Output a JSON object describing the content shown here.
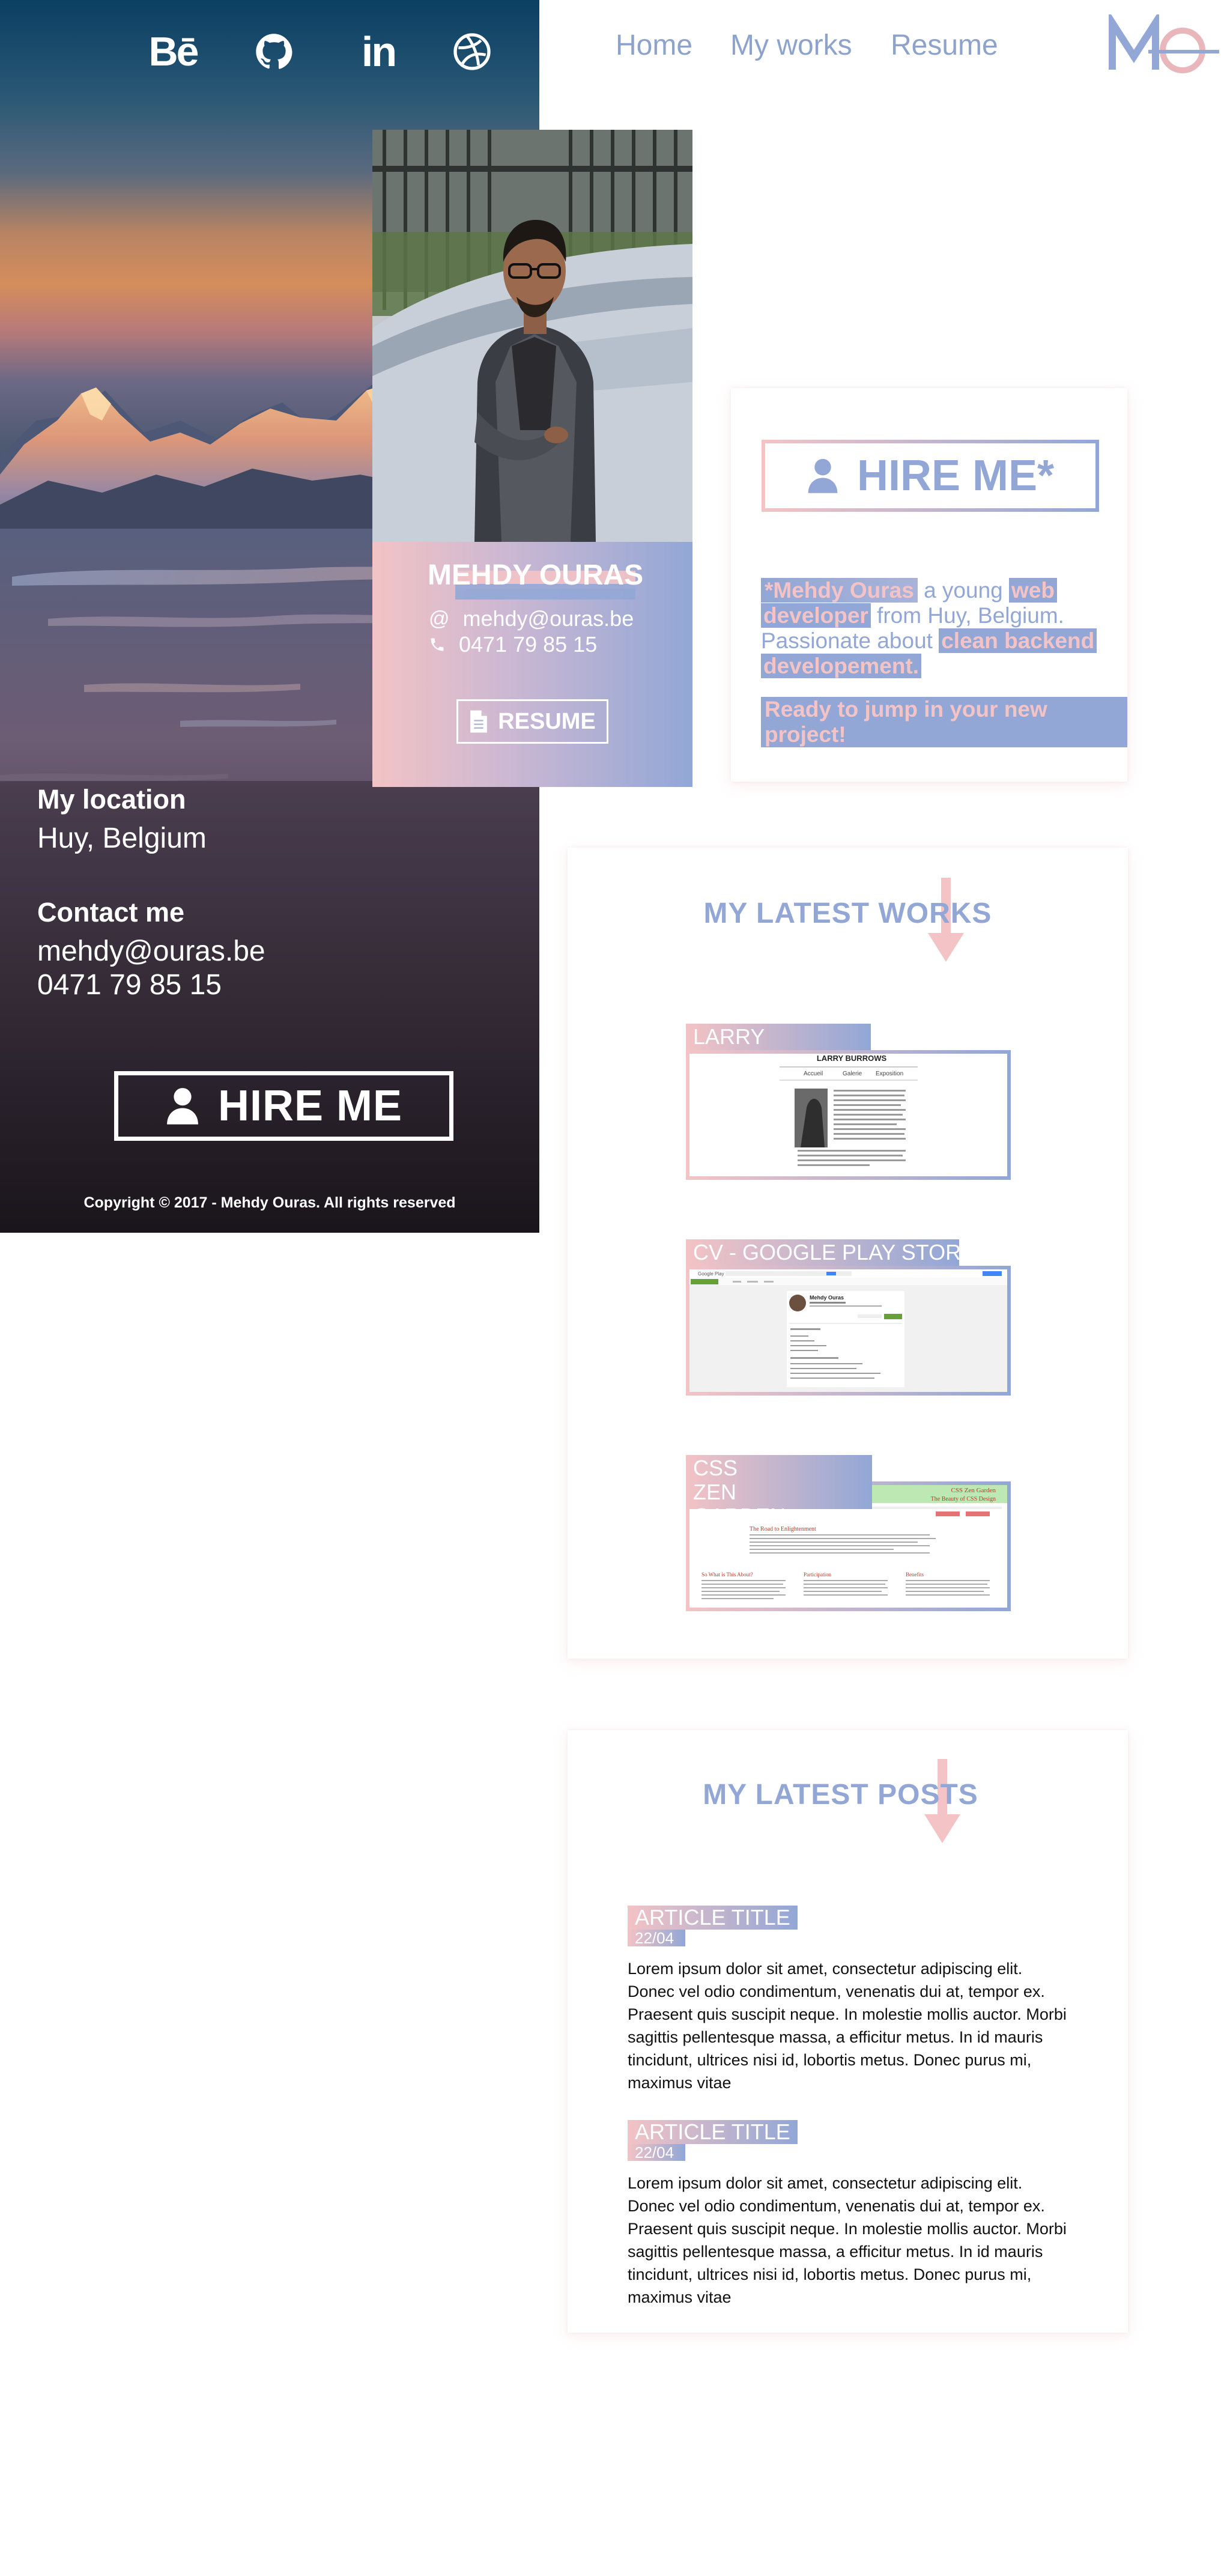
{
  "nav": {
    "links": [
      "Home",
      "My works",
      "Resume"
    ],
    "logo_text": "MO"
  },
  "social": [
    "behance-icon",
    "github-icon",
    "linkedin-icon",
    "dribbble-icon"
  ],
  "social_text": {
    "behance": "Bē",
    "linkedin": "in"
  },
  "hero": {
    "location_label": "My location",
    "location_value": "Huy, Belgium",
    "contact_label": "Contact me",
    "contact_email": "mehdy@ouras.be",
    "contact_phone": "0471 79 85 15",
    "hire_label": "HIRE ME",
    "copyright": "Copyright © 2017 - Mehdy Ouras. All rights reserved"
  },
  "profile": {
    "name": "MEHDY OURAS",
    "email": "mehdy@ouras.be",
    "phone": "0471 79 85 15",
    "resume_label": "RESUME"
  },
  "hire_card": {
    "title": "HIRE ME*",
    "name": "*Mehdy Ouras",
    "young": " a young ",
    "role1": "web",
    "role2": "developer",
    "from": " from Huy, Belgium.",
    "passion": "Passionate about ",
    "skill1": "clean backend",
    "skill2": "developement.",
    "cta": "Ready to jump in your new project!"
  },
  "works": {
    "title": "MY LATEST WORKS",
    "items": [
      {
        "tag": "LARRY",
        "preview_title": "LARRY BURROWS",
        "preview_nav": [
          "Accueil",
          "Galerie",
          "Exposition"
        ]
      },
      {
        "tag": "CV - GOOGLE PLAY STORE",
        "preview_title": "Mehdy Ouras",
        "preview_app": "Google Play"
      },
      {
        "tag": "CSS ZEN GARDEN",
        "preview_title": "CSS Zen Garden",
        "preview_sub": "The Beauty of CSS Design",
        "preview_heading": "The Road to Enlightenment",
        "preview_cols": [
          "So What is This About?",
          "Participation",
          "Benefits"
        ]
      }
    ]
  },
  "posts": {
    "title": "MY LATEST POSTS",
    "items": [
      {
        "title": "ARTICLE TITLE",
        "date": "22/04",
        "body": "Lorem ipsum dolor sit amet, consectetur adipiscing elit. Donec vel odio condimentum, venenatis dui at, tempor ex. Praesent quis suscipit neque. In molestie mollis auctor. Morbi sagittis pellentesque massa, a efficitur metus. In id mauris tincidunt, ultrices nisi id, lobortis metus. Donec purus mi, maximus vitae"
      },
      {
        "title": "ARTICLE TITLE",
        "date": "22/04",
        "body": "Lorem ipsum dolor sit amet, consectetur adipiscing elit. Donec vel odio condimentum, venenatis dui at, tempor ex. Praesent quis suscipit neque. In molestie mollis auctor. Morbi sagittis pellentesque massa, a efficitur metus. In id mauris tincidunt, ultrices nisi id, lobortis metus. Donec purus mi, maximus vitae"
      }
    ]
  },
  "colors": {
    "pink": "#f3c3c5",
    "blue": "#92a7d6"
  }
}
